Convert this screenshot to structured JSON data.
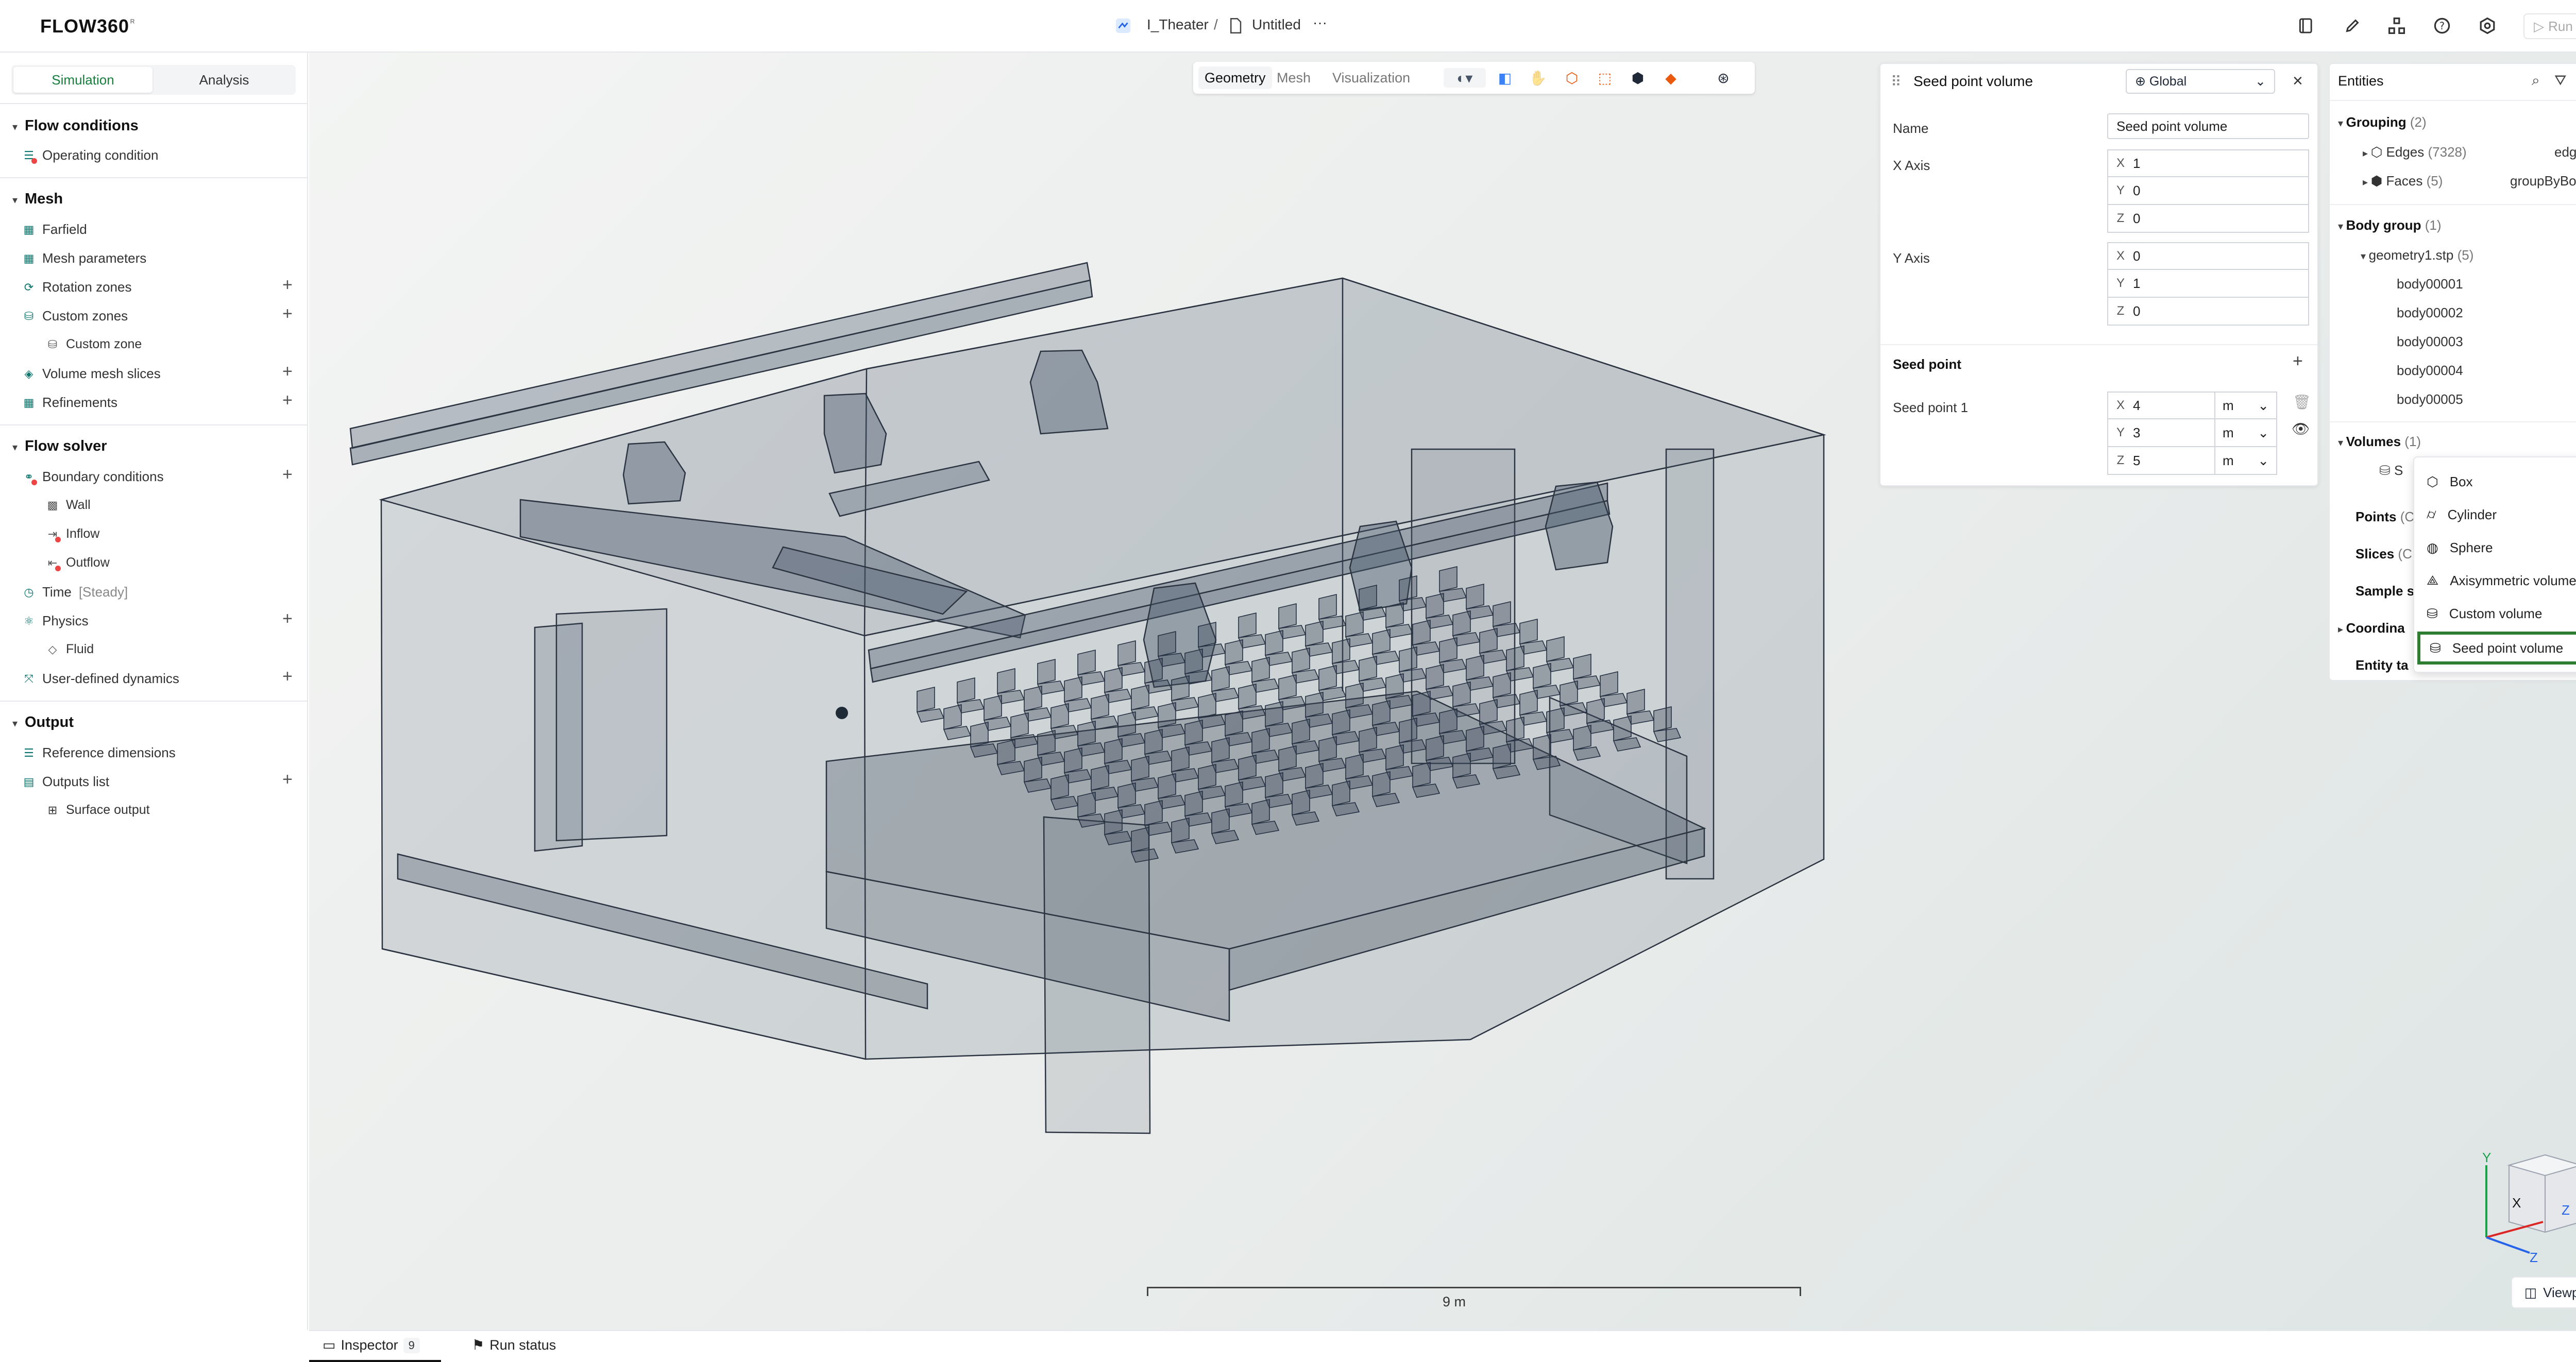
{
  "app": {
    "logo": "FLOW360",
    "logo_mark": "ᴿ"
  },
  "topbar": {
    "project": "I_Theater",
    "separator": "/",
    "file": "Untitled",
    "more": "···",
    "run_label": "Run"
  },
  "left": {
    "tabs": [
      "Simulation",
      "Analysis"
    ],
    "active_tab": "Simulation",
    "sections": {
      "flow_conditions": {
        "title": "Flow conditions",
        "items": [
          "Operating condition"
        ]
      },
      "mesh": {
        "title": "Mesh",
        "items": [
          "Farfield",
          "Mesh parameters",
          "Rotation zones",
          "Custom zones",
          "Custom zone",
          "Volume mesh slices",
          "Refinements"
        ]
      },
      "flow_solver": {
        "title": "Flow solver",
        "items": [
          "Boundary conditions",
          "Wall",
          "Inflow",
          "Outflow",
          "Time",
          "Physics",
          "Fluid",
          "User-defined dynamics"
        ],
        "time_mode": "[Steady]"
      },
      "output": {
        "title": "Output",
        "items": [
          "Reference dimensions",
          "Outputs list",
          "Surface output"
        ]
      }
    }
  },
  "viewport": {
    "tabs": [
      "Geometry",
      "Mesh",
      "Visualization"
    ],
    "active_tab": "Geometry",
    "scale_label": "9 m",
    "viewpoint_label": "Viewpoint",
    "axis_labels": [
      "Y",
      "X",
      "Z",
      "Z"
    ]
  },
  "inspector_panel": {
    "title": "Seed point volume",
    "frame": "Global",
    "name_label": "Name",
    "name_value": "Seed point volume",
    "x_axis_label": "X Axis",
    "x_axis": [
      "1",
      "0",
      "0"
    ],
    "y_axis_label": "Y Axis",
    "y_axis": [
      "0",
      "1",
      "0"
    ],
    "axis_letters": [
      "X",
      "Y",
      "Z"
    ],
    "seed_point_header": "Seed point",
    "seed_point_1_label": "Seed point 1",
    "seed_point_1": [
      "4",
      "3",
      "5"
    ],
    "unit": "m"
  },
  "entities": {
    "title": "Entities",
    "grouping": {
      "label": "Grouping",
      "count": "(2)",
      "edges": {
        "label": "Edges",
        "count": "(7328)",
        "value": "edgeId"
      },
      "faces": {
        "label": "Faces",
        "count": "(5)",
        "value": "groupByBodyId"
      }
    },
    "body_group": {
      "label": "Body group",
      "count": "(1)",
      "file": "geometry1.stp",
      "file_count": "(5)",
      "bodies": [
        "body00001",
        "body00002",
        "body00003",
        "body00004",
        "body00005"
      ]
    },
    "volumes": {
      "label": "Volumes",
      "count": "(1)",
      "item_initial": "S"
    },
    "points": {
      "label": "Points",
      "count": "(C"
    },
    "slices": {
      "label": "Slices",
      "count": "(C"
    },
    "sample": {
      "label": "Sample s"
    },
    "coordinate": {
      "label": "Coordina"
    },
    "entity_tags": {
      "label": "Entity ta"
    }
  },
  "dropdown": {
    "items": [
      "Box",
      "Cylinder",
      "Sphere",
      "Axisymmetric volume",
      "Custom volume",
      "Seed point volume"
    ],
    "selected": "Seed point volume"
  },
  "bottom": {
    "inspector_label": "Inspector",
    "inspector_count": "9",
    "run_status_label": "Run status",
    "close": "×"
  }
}
